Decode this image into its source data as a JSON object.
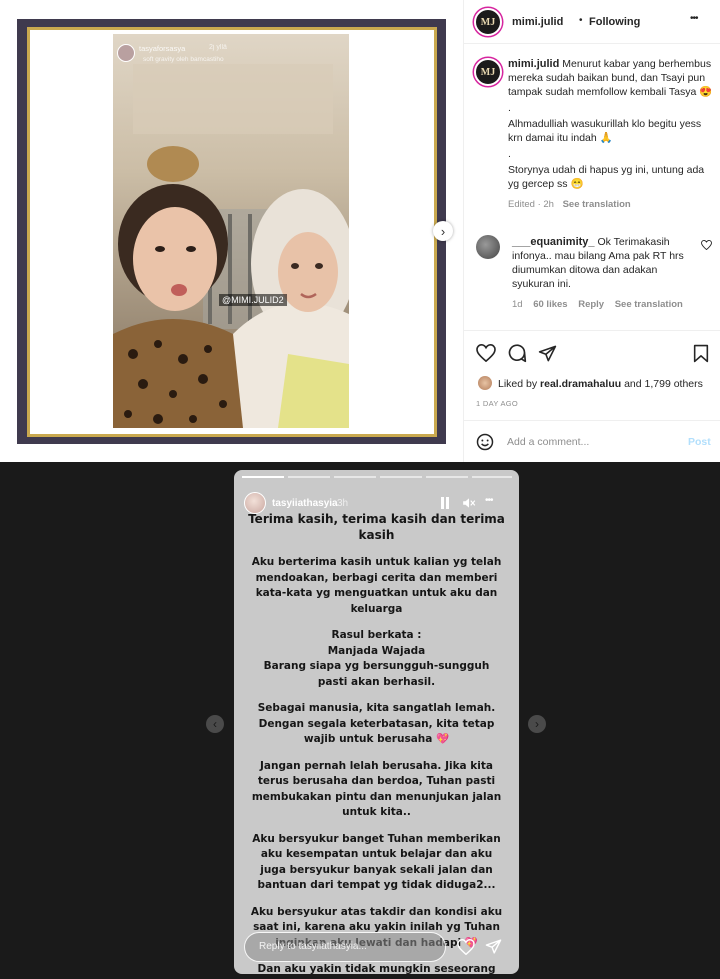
{
  "post": {
    "username": "mimi.julid",
    "separator": "•",
    "follow_state": "Following",
    "more": "•••",
    "avatar_text": "MJ",
    "photo": {
      "story_user": "tasyaforsasya",
      "story_time": "2j yllä",
      "story_music": "soft gravity oleh bamcastiho",
      "watermark": "@MIMI.JULID2"
    },
    "caption": {
      "author": "mimi.julid",
      "line1": "Menurut kabar yang berhembus mereka sudah baikan bund, dan Tsayi pun tampak sudah memfollow kembali Tasya 😍",
      "dot1": ".",
      "line2": "Alhmadulliah wasukurillah klo begitu yess krn damai itu indah 🙏",
      "dot2": ".",
      "line3": "Storynya udah di hapus yg ini, untung ada yg gercep ss 😁",
      "edited": "Edited · 2h",
      "see_translation": "See translation"
    },
    "comment": {
      "author": "___equanimity_",
      "text": "Ok Terimakasih infonya.. mau bilang Ama pak RT hrs diumumkan ditowa dan adakan syukuran ini.",
      "age": "1d",
      "likes": "60 likes",
      "reply": "Reply",
      "see_translation": "See translation"
    },
    "likes": {
      "prefix": "Liked by",
      "user": "real.dramahaluu",
      "suffix": "and 1,799 others"
    },
    "date": "1 DAY AGO",
    "add_comment": {
      "placeholder": "Add a comment...",
      "post_label": "Post"
    }
  },
  "story": {
    "username": "tasyiiathasyia",
    "time": "3h",
    "more": "•••",
    "title": "Terima kasih, terima kasih dan terima kasih",
    "paragraphs": [
      "Aku berterima kasih untuk kalian yg telah mendoakan, berbagi cerita dan memberi kata-kata yg menguatkan untuk aku dan keluarga",
      "Rasul berkata :\nManjada Wajada\nBarang siapa yg bersungguh-sungguh pasti akan berhasil.",
      "Sebagai manusia, kita sangatlah lemah.\nDengan segala keterbatasan, kita tetap wajib untuk berusaha 💖",
      "Jangan pernah lelah berusaha. Jika kita terus berusaha dan berdoa, Tuhan pasti membukakan pintu dan menunjukan jalan untuk kita..",
      "Aku bersyukur banget Tuhan memberikan aku kesempatan untuk belajar dan aku juga bersyukur banyak sekali jalan dan bantuan dari tempat yg tidak diduga2...",
      "Aku bersyukur atas takdir dan kondisi aku saat ini, karena aku yakin inilah yg Tuhan inginkan aku lewati dan hadapi 💖",
      "Dan aku yakin tidak mungkin seseorang diberikan ujian yg melebihi batas kemampuan kita 🙏"
    ],
    "reply_placeholder": "Reply to tasyiiathasyia..."
  },
  "colors": {
    "dark_bg": "#1a1a1a",
    "frame": "#3f3a4e",
    "gold": "#c9a94f",
    "link": "#0095f6"
  }
}
